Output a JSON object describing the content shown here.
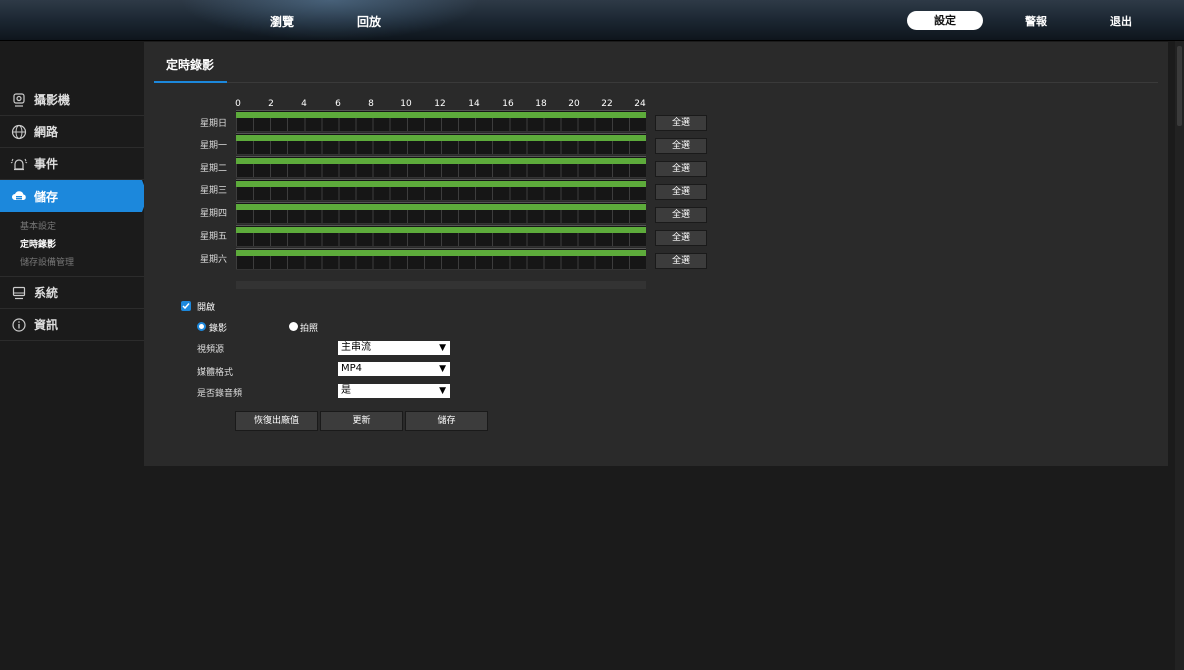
{
  "topnav": {
    "browse": "瀏覽",
    "playback": "回放",
    "settings": "設定",
    "alarm": "警報",
    "logout": "退出"
  },
  "sidebar": {
    "camera": "攝影機",
    "network": "網路",
    "event": "事件",
    "storage": "儲存",
    "storage_sub": [
      "基本設定",
      "定時錄影",
      "儲存設備管理"
    ],
    "system": "系統",
    "info": "資訊"
  },
  "page": {
    "title": "定時錄影"
  },
  "schedule": {
    "hours": [
      "0",
      "2",
      "4",
      "6",
      "8",
      "10",
      "12",
      "14",
      "16",
      "18",
      "20",
      "22",
      "24"
    ],
    "days": [
      "星期日",
      "星期一",
      "星期二",
      "星期三",
      "星期四",
      "星期五",
      "星期六"
    ],
    "select_all": "全選",
    "recorded_fraction": 1.0,
    "record_color": "#5dab3b"
  },
  "options": {
    "enable_label": "開啟",
    "enable_checked": true,
    "mode_record": "錄影",
    "mode_snapshot": "拍照",
    "video_source_label": "視頻源",
    "video_source_value": "主串流",
    "media_format_label": "媒體格式",
    "media_format_value": "MP4",
    "record_audio_label": "是否錄音頻",
    "record_audio_value": "是"
  },
  "buttons": {
    "restore": "恢復出廠值",
    "refresh": "更新",
    "save": "儲存"
  },
  "colors": {
    "accent": "#1c88dc",
    "panel": "#2a2a2a",
    "background": "#1b1b1b"
  }
}
